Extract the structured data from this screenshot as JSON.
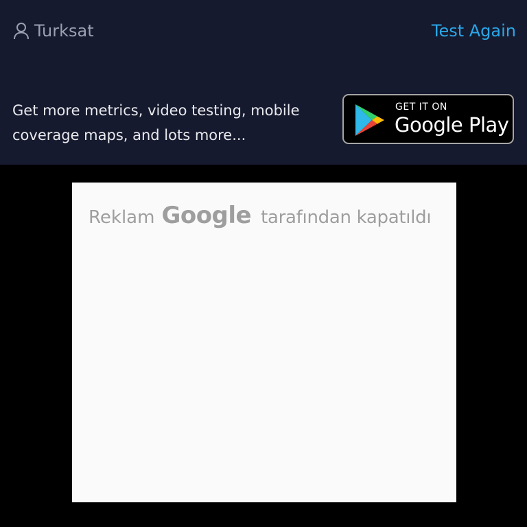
{
  "header": {
    "provider_name": "Turksat",
    "provider_icon": "user-icon",
    "test_again_label": "Test Again",
    "accent_color": "#2aa7e8"
  },
  "promo": {
    "text": "Get more metrics, video testing, mobile coverage maps, and lots more...",
    "badge": {
      "line1": "GET IT ON",
      "line2": "Google Play",
      "icon": "google-play-icon"
    }
  },
  "ad": {
    "prefix": "Reklam",
    "brand": "Google",
    "suffix": "tarafından kapatıldı"
  }
}
